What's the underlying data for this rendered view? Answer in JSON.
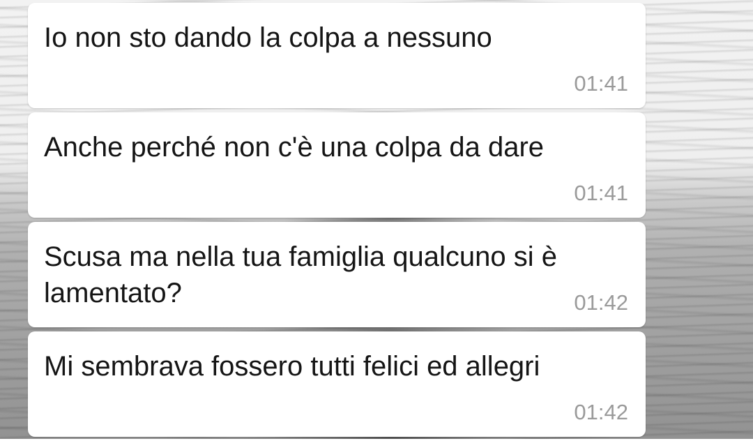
{
  "chat": {
    "messages": [
      {
        "text": "Io non sto dando la colpa a nessuno",
        "time": "01:41"
      },
      {
        "text": "Anche perché non c'è una colpa da dare",
        "time": "01:41"
      },
      {
        "text": "Scusa ma nella tua famiglia qualcuno si è lamentato?",
        "time": "01:42"
      },
      {
        "text": "Mi sembrava fossero tutti felici ed allegri",
        "time": "01:42"
      }
    ]
  }
}
